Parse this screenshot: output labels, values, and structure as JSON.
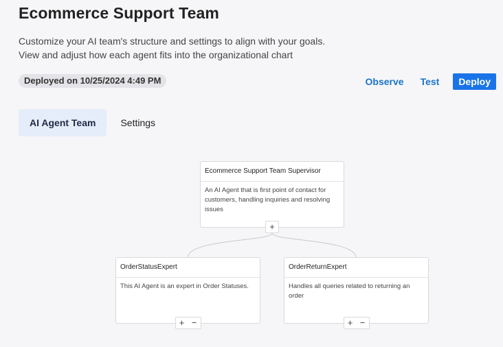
{
  "header": {
    "title": "Ecommerce Support Team",
    "description_line1": "Customize your AI team's structure and settings to align with your goals.",
    "description_line2": "View and adjust how each agent fits into the organizational chart",
    "deploy_status": "Deployed on 10/25/2024 4:49 PM"
  },
  "actions": {
    "observe": "Observe",
    "test": "Test",
    "deploy": "Deploy"
  },
  "tabs": [
    {
      "label": "AI Agent Team",
      "active": true
    },
    {
      "label": "Settings",
      "active": false
    }
  ],
  "colors": {
    "accent": "#1a73e8",
    "link": "#1a73c9",
    "active_tab_bg": "#e6edfa"
  },
  "org_chart": {
    "supervisor": {
      "title": "Ecommerce Support Team Supervisor",
      "description": "An AI Agent that is first point of contact for customers, handling inquiries and resolving issues",
      "controls": [
        "+"
      ]
    },
    "children": [
      {
        "title": "OrderStatusExpert",
        "description": "This AI Agent is an expert in Order Statuses.",
        "controls": [
          "+",
          "−"
        ]
      },
      {
        "title": "OrderReturnExpert",
        "description": "Handles all queries related to returning an order",
        "controls": [
          "+",
          "−"
        ]
      }
    ]
  }
}
